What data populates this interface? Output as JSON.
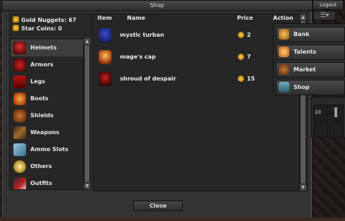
{
  "window": {
    "title": "Shop",
    "close_label": "Close"
  },
  "balance": {
    "gold_label": "Gold Nuggets: 67",
    "star_label": "Star Coins: 0"
  },
  "categories": [
    {
      "label": "Helmets",
      "icon": "helmet-icon",
      "active": true
    },
    {
      "label": "Armors",
      "icon": "armor-icon"
    },
    {
      "label": "Legs",
      "icon": "legs-icon"
    },
    {
      "label": "Boots",
      "icon": "boots-icon"
    },
    {
      "label": "Shields",
      "icon": "shield-icon"
    },
    {
      "label": "Weapons",
      "icon": "weapon-icon"
    },
    {
      "label": "Ammo Slots",
      "icon": "ammo-icon"
    },
    {
      "label": "Others",
      "icon": "others-icon"
    },
    {
      "label": "Outfits",
      "icon": "outfit-icon"
    }
  ],
  "table": {
    "headers": {
      "item": "Item",
      "name": "Name",
      "price": "Price",
      "action": "Action"
    },
    "rows": [
      {
        "name": "mystic turban",
        "price": "2",
        "icon": "turban-icon"
      },
      {
        "name": "mage's cap",
        "price": "7",
        "icon": "mage-cap-icon"
      },
      {
        "name": "shroud of despair",
        "price": "15",
        "icon": "shroud-icon"
      }
    ]
  },
  "top_right": {
    "logout_label": "Logout",
    "menu_icon": "hamburger-icon"
  },
  "side_menu": [
    {
      "label": "Bank",
      "icon": "bank-icon"
    },
    {
      "label": "Talents",
      "icon": "talents-icon"
    },
    {
      "label": "Market",
      "icon": "market-icon"
    },
    {
      "label": "Shop",
      "icon": "shop-icon"
    }
  ],
  "equipment": {
    "slot_count": "10"
  },
  "colors": {
    "gold": "#e0b43a",
    "panel": "#262626",
    "window": "#333333"
  }
}
